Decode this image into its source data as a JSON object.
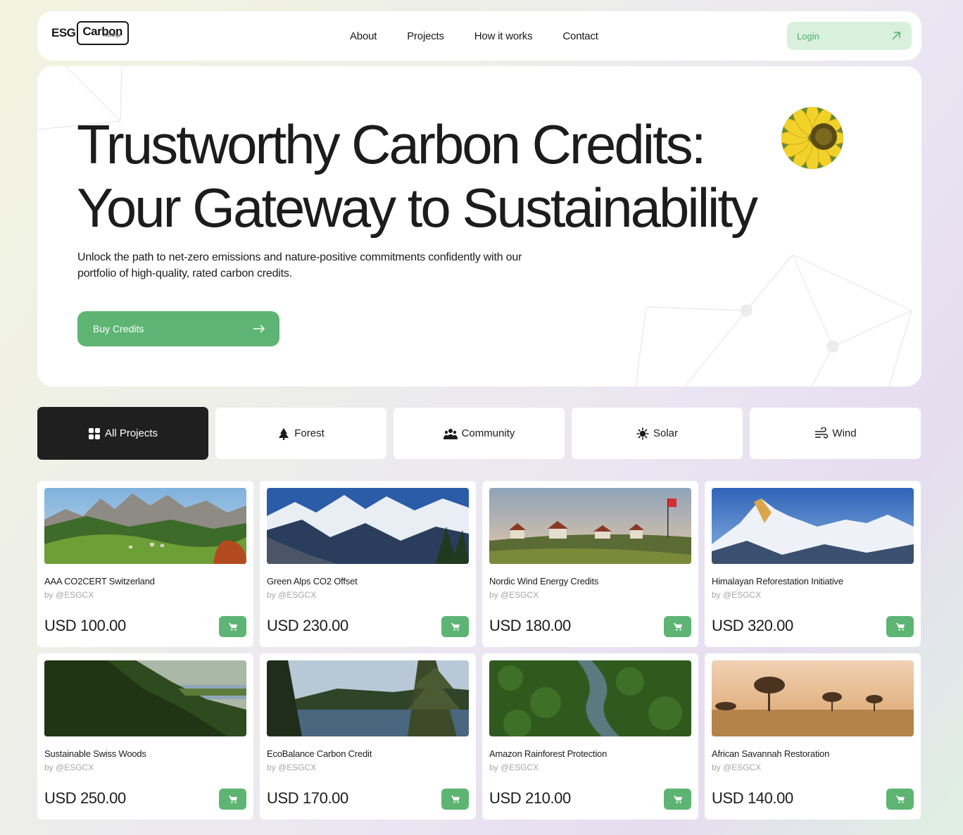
{
  "brand": {
    "name_esg": "ESG",
    "name_carbon": "Carbon",
    "name_sub": "exchange"
  },
  "nav": {
    "links": [
      "About",
      "Projects",
      "How it works",
      "Contact"
    ],
    "login_label": "Login"
  },
  "hero": {
    "title_line1": "Trustworthy Carbon Credits:",
    "title_line2": "Your Gateway to Sustainability",
    "subtitle": "Unlock the path to net-zero emissions and nature-positive commitments confidently with our portfolio of high-quality, rated carbon credits.",
    "cta_label": "Buy Credits"
  },
  "tabs": [
    {
      "label": "All Projects",
      "icon": "grid-icon",
      "active": true
    },
    {
      "label": "Forest",
      "icon": "forest-icon",
      "active": false
    },
    {
      "label": "Community",
      "icon": "community-icon",
      "active": false
    },
    {
      "label": "Solar",
      "icon": "sun-icon",
      "active": false
    },
    {
      "label": "Wind",
      "icon": "wind-icon",
      "active": false
    }
  ],
  "projects": [
    {
      "title": "AAA CO2CERT Switzerland",
      "author": "by @ESGCX",
      "price": "USD 100.00",
      "image": "alpine-meadow"
    },
    {
      "title": "Green Alps CO2 Offset",
      "author": "by @ESGCX",
      "price": "USD 230.00",
      "image": "snowy-mountains"
    },
    {
      "title": "Nordic Wind Energy Credits",
      "author": "by @ESGCX",
      "price": "USD 180.00",
      "image": "village-flag"
    },
    {
      "title": "Himalayan Reforestation Initiative",
      "author": "by @ESGCX",
      "price": "USD 320.00",
      "image": "himalaya-peaks"
    },
    {
      "title": "Sustainable Swiss Woods",
      "author": "by @ESGCX",
      "price": "USD 250.00",
      "image": "forest-hillside"
    },
    {
      "title": "EcoBalance Carbon Credit",
      "author": "by @ESGCX",
      "price": "USD 170.00",
      "image": "lake-pines"
    },
    {
      "title": "Amazon Rainforest Protection",
      "author": "by @ESGCX",
      "price": "USD 210.00",
      "image": "rainforest-river"
    },
    {
      "title": "African Savannah Restoration",
      "author": "by @ESGCX",
      "price": "USD 140.00",
      "image": "savannah-trees"
    }
  ],
  "colors": {
    "accent": "#5eb573",
    "accent_light": "#d8f0dc",
    "dark": "#1f1f1f"
  }
}
